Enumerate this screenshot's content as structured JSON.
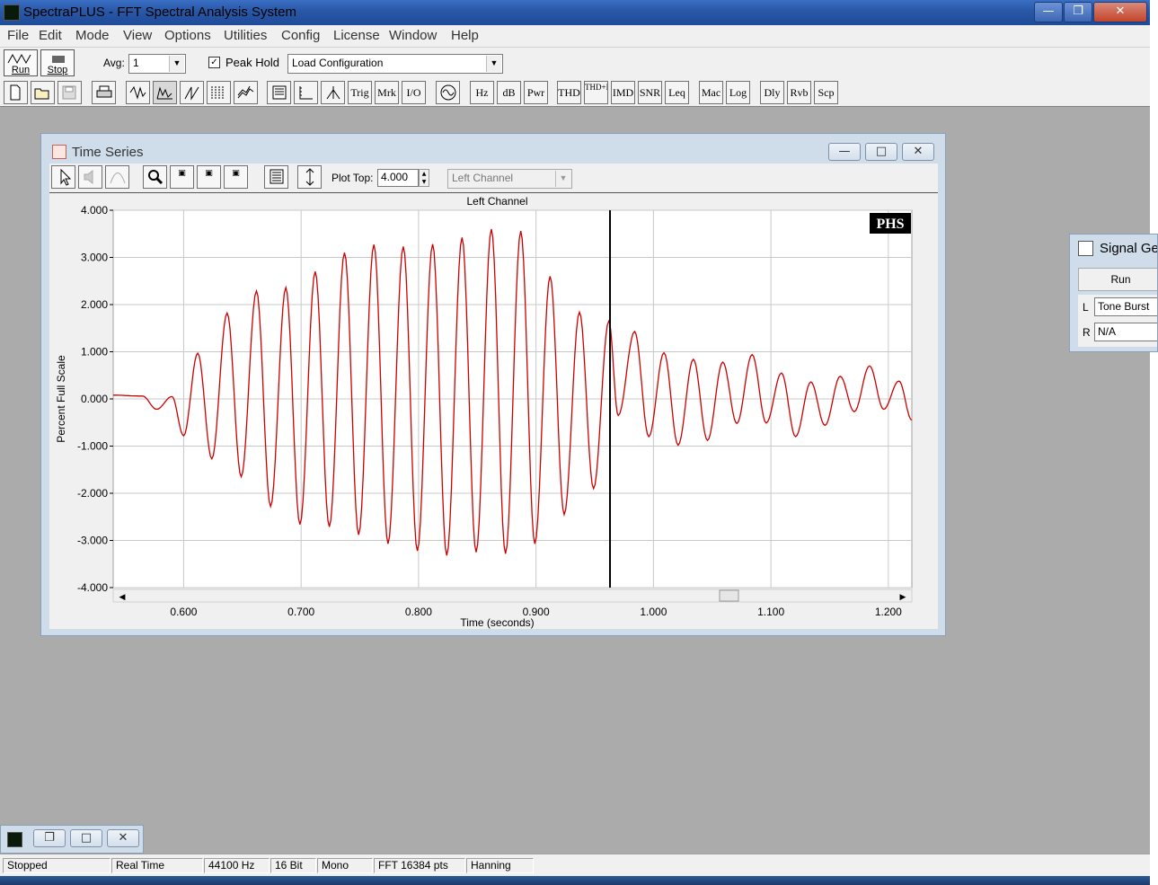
{
  "app": {
    "title": "SpectraPLUS - FFT Spectral Analysis System",
    "icon": "spectrum-app-icon"
  },
  "menu": [
    "File",
    "Edit",
    "Mode",
    "View",
    "Options",
    "Utilities",
    "Config",
    "License",
    "Window",
    "Help"
  ],
  "toolbar1": {
    "run_label": "Run",
    "stop_label": "Stop",
    "avg_label": "Avg:",
    "avg_value": "1",
    "peak_hold_label": "Peak Hold",
    "peak_hold_checked": true,
    "config_value": "Load Configuration"
  },
  "toolbar2": {
    "buttons": [
      "new-icon",
      "open-icon",
      "save-icon",
      "print-icon",
      "time-series-icon",
      "spectrum-icon",
      "phase-icon",
      "spectrogram-icon",
      "3d-surface-icon",
      "settings-icon",
      "scaling-icon",
      "trigger-icon",
      "Trig",
      "Mrk",
      "I/O",
      "signal-generator-icon",
      "Hz",
      "dB",
      "Pwr",
      "THD",
      "THD+N",
      "IMD",
      "SNR",
      "Leq",
      "Mac",
      "Log",
      "Dly",
      "Rvb",
      "Scp"
    ]
  },
  "time_series": {
    "title": "Time Series",
    "plot_top_label": "Plot Top:",
    "plot_top_value": "4.000",
    "channel_value": "Left Channel",
    "logo": "PHS"
  },
  "signal_generator": {
    "title": "Signal Gen",
    "run_label": "Run",
    "left_label": "L",
    "left_value": "Tone Burst",
    "right_label": "R",
    "right_value": "N/A"
  },
  "status": {
    "state": "Stopped",
    "mode": "Real Time",
    "rate": "44100 Hz",
    "bits": "16 Bit",
    "channels": "Mono",
    "fft": "FFT 16384 pts",
    "window": "Hanning"
  },
  "chart_data": {
    "type": "line",
    "title": "Left Channel",
    "xlabel": "Time (seconds)",
    "ylabel": "Percent Full Scale",
    "xlim": [
      0.54,
      1.22
    ],
    "ylim": [
      -4.0,
      4.0
    ],
    "x_ticks": [
      "0.600",
      "0.700",
      "0.800",
      "0.900",
      "1.000",
      "1.100",
      "1.200"
    ],
    "x_tick_values": [
      0.6,
      0.7,
      0.8,
      0.9,
      1.0,
      1.1,
      1.2
    ],
    "y_ticks": [
      "4.000",
      "3.000",
      "2.000",
      "1.000",
      "0.000",
      "-1.000",
      "-2.000",
      "-3.000",
      "-4.000"
    ],
    "y_tick_values": [
      4,
      3,
      2,
      1,
      0,
      -1,
      -2,
      -3,
      -4
    ],
    "grid": true,
    "series_color": "#cc0000",
    "cursor_x": 0.963,
    "extrema": [
      [
        0.54,
        0.08
      ],
      [
        0.565,
        0.06
      ],
      [
        0.577,
        -0.22
      ],
      [
        0.59,
        0.05
      ],
      [
        0.6,
        -0.78
      ],
      [
        0.612,
        0.97
      ],
      [
        0.624,
        -1.27
      ],
      [
        0.637,
        1.82
      ],
      [
        0.649,
        -1.65
      ],
      [
        0.662,
        2.29
      ],
      [
        0.674,
        -2.28
      ],
      [
        0.687,
        2.36
      ],
      [
        0.699,
        -2.66
      ],
      [
        0.712,
        2.7
      ],
      [
        0.724,
        -2.71
      ],
      [
        0.737,
        3.1
      ],
      [
        0.749,
        -2.88
      ],
      [
        0.762,
        3.27
      ],
      [
        0.774,
        -3.07
      ],
      [
        0.787,
        3.23
      ],
      [
        0.799,
        -3.22
      ],
      [
        0.812,
        3.28
      ],
      [
        0.824,
        -3.32
      ],
      [
        0.837,
        3.42
      ],
      [
        0.849,
        -3.25
      ],
      [
        0.862,
        3.6
      ],
      [
        0.874,
        -3.28
      ],
      [
        0.887,
        3.56
      ],
      [
        0.899,
        -3.07
      ],
      [
        0.912,
        2.6
      ],
      [
        0.924,
        -2.45
      ],
      [
        0.937,
        1.84
      ],
      [
        0.949,
        -1.9
      ],
      [
        0.962,
        1.65
      ],
      [
        0.97,
        -0.35
      ],
      [
        0.984,
        1.43
      ],
      [
        0.996,
        -0.8
      ],
      [
        1.009,
        0.98
      ],
      [
        1.021,
        -0.98
      ],
      [
        1.034,
        0.84
      ],
      [
        1.046,
        -0.88
      ],
      [
        1.059,
        0.78
      ],
      [
        1.071,
        -0.52
      ],
      [
        1.084,
        0.94
      ],
      [
        1.096,
        -0.51
      ],
      [
        1.109,
        0.55
      ],
      [
        1.121,
        -0.8
      ],
      [
        1.134,
        0.36
      ],
      [
        1.146,
        -0.56
      ],
      [
        1.159,
        0.48
      ],
      [
        1.171,
        -0.27
      ],
      [
        1.184,
        0.7
      ],
      [
        1.196,
        -0.22
      ],
      [
        1.209,
        0.38
      ],
      [
        1.22,
        -0.45
      ]
    ]
  }
}
